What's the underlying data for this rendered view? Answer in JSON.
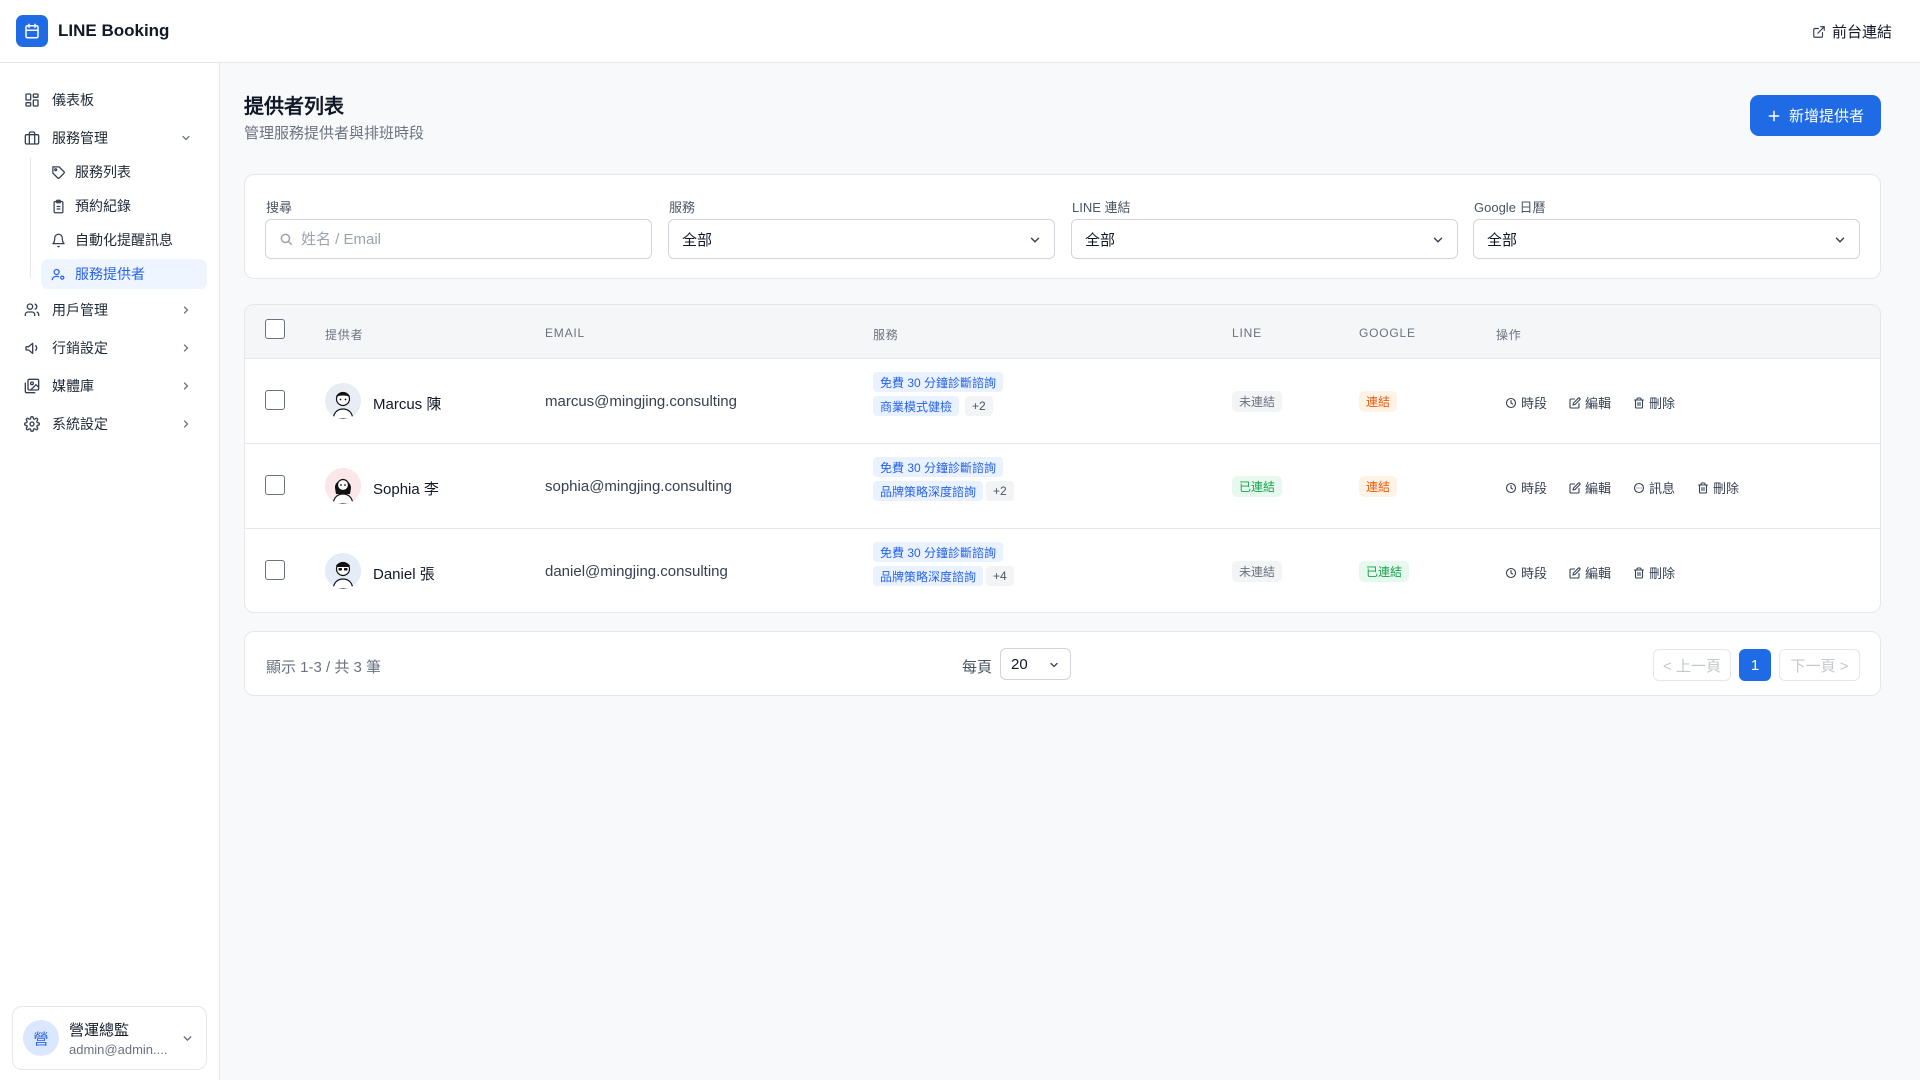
{
  "app": {
    "title": "LINE Booking",
    "front_link": "前台連結"
  },
  "sidebar": {
    "dashboard": "儀表板",
    "service_mgmt": "服務管理",
    "service_sub": [
      "服務列表",
      "預約紀錄",
      "自動化提醒訊息",
      "服務提供者"
    ],
    "user_mgmt": "用戶管理",
    "marketing": "行銷設定",
    "media": "媒體庫",
    "system": "系統設定",
    "user": {
      "avatar_char": "營",
      "name": "營運總監",
      "email": "admin@admin...."
    }
  },
  "page": {
    "title": "提供者列表",
    "subtitle": "管理服務提供者與排班時段",
    "add_button": "新增提供者"
  },
  "filters": {
    "search_label": "搜尋",
    "search_placeholder": "姓名 / Email",
    "service_label": "服務",
    "service_value": "全部",
    "line_label": "LINE 連結",
    "line_value": "全部",
    "google_label": "Google 日曆",
    "google_value": "全部"
  },
  "table": {
    "headers": {
      "provider": "提供者",
      "email": "EMAIL",
      "service": "服務",
      "line": "LINE",
      "google": "GOOGLE",
      "actions": "操作"
    },
    "rows": [
      {
        "name": "Marcus 陳",
        "email": "marcus@mingjing.consulting",
        "tag1": "免費 30 分鐘診斷諮詢",
        "tag2": "商業模式健檢",
        "more": "+2",
        "line": "未連結",
        "google": "連結",
        "act_slot": "時段",
        "act_edit": "編輯",
        "act_delete": "刪除"
      },
      {
        "name": "Sophia 李",
        "email": "sophia@mingjing.consulting",
        "tag1": "免費 30 分鐘診斷諮詢",
        "tag2": "品牌策略深度諮詢",
        "more": "+2",
        "line": "已連結",
        "google": "連結",
        "act_slot": "時段",
        "act_edit": "編輯",
        "act_msg": "訊息",
        "act_delete": "刪除"
      },
      {
        "name": "Daniel 張",
        "email": "daniel@mingjing.consulting",
        "tag1": "免費 30 分鐘診斷諮詢",
        "tag2": "品牌策略深度諮詢",
        "more": "+4",
        "line": "未連結",
        "google": "已連結",
        "act_slot": "時段",
        "act_edit": "編輯",
        "act_delete": "刪除"
      }
    ]
  },
  "pagination": {
    "info": "顯示 1-3 / 共 3 筆",
    "per_page_label": "每頁",
    "per_page_value": "20",
    "prev": "< 上一頁",
    "current": "1",
    "next": "下一頁 >"
  },
  "colors": {
    "accent": "#1f6ae5",
    "active_nav_bg": "#eff5ff",
    "success": "#16a34a",
    "warning": "#ea580c"
  },
  "icons": [
    "calendar-icon",
    "external-link-icon",
    "grid-icon",
    "briefcase-icon",
    "tag-icon",
    "clipboard-icon",
    "bell-icon",
    "user-cog-icon",
    "users-icon",
    "megaphone-icon",
    "images-icon",
    "gear-icon",
    "chevron-down-icon",
    "chevron-right-icon",
    "plus-icon",
    "search-icon",
    "clock-icon",
    "edit-icon",
    "message-icon",
    "trash-icon"
  ]
}
